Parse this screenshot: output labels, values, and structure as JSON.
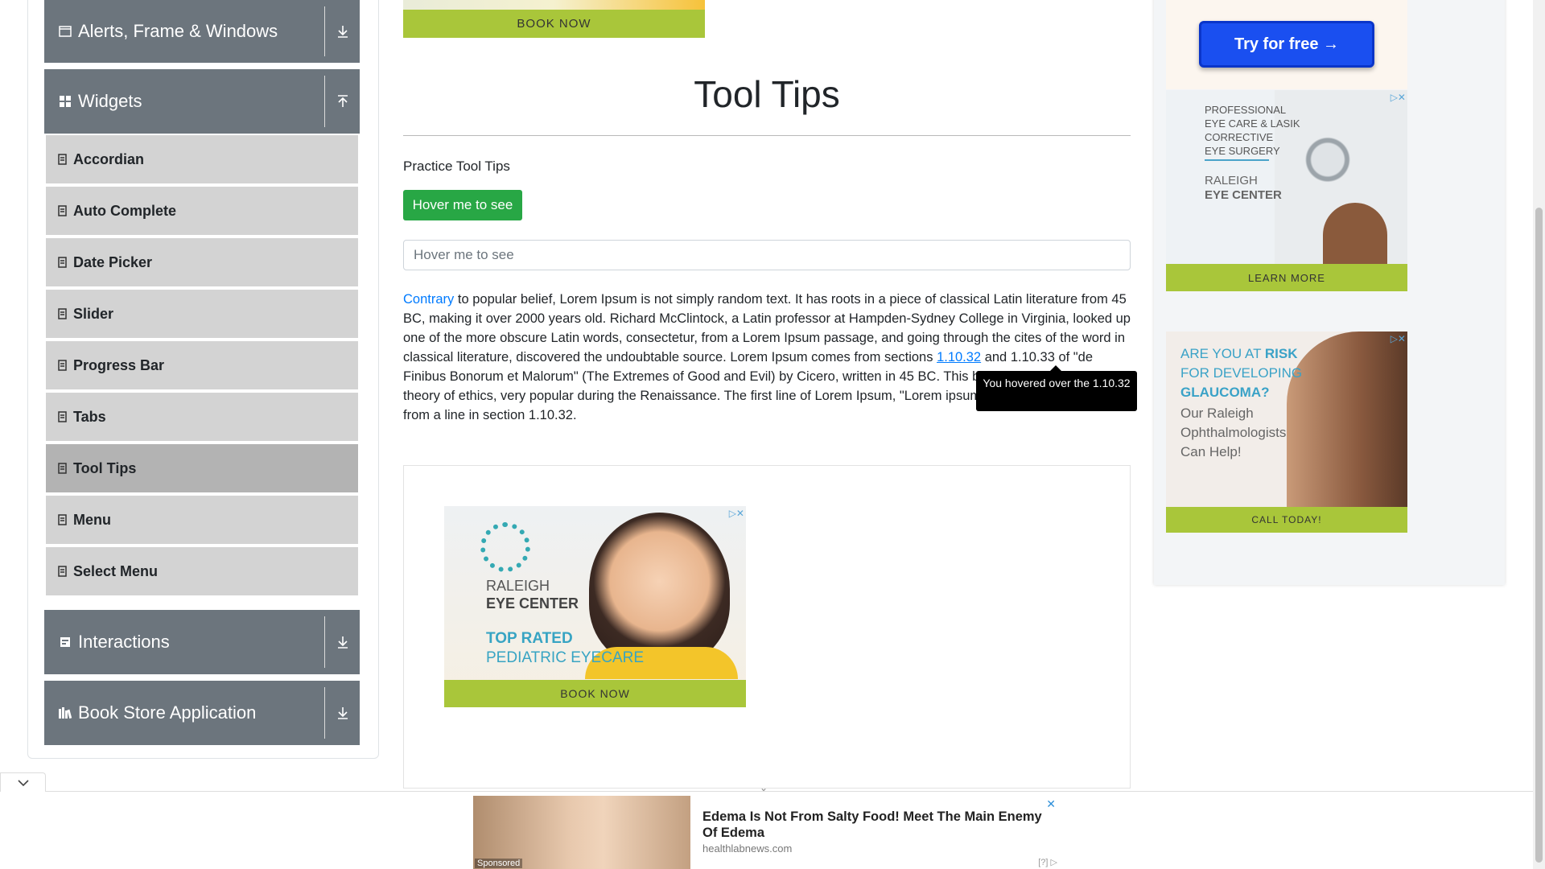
{
  "sidebar": {
    "groups": {
      "alerts": {
        "label": "Alerts, Frame & Windows",
        "icon": "window-icon",
        "arrow": "download-arrow-icon"
      },
      "widgets": {
        "label": "Widgets",
        "icon": "grid-icon",
        "arrow": "upload-arrow-icon"
      },
      "interactions": {
        "label": "Interactions",
        "icon": "interaction-icon",
        "arrow": "download-arrow-icon"
      },
      "bookstore": {
        "label": "Book Store Application",
        "icon": "books-icon",
        "arrow": "download-arrow-icon"
      }
    },
    "items": [
      {
        "label": "Accordian"
      },
      {
        "label": "Auto Complete"
      },
      {
        "label": "Date Picker"
      },
      {
        "label": "Slider"
      },
      {
        "label": "Progress Bar"
      },
      {
        "label": "Tabs"
      },
      {
        "label": "Tool Tips"
      },
      {
        "label": "Menu"
      },
      {
        "label": "Select Menu"
      }
    ],
    "active_item": "Tool Tips"
  },
  "top_banner": {
    "cta": "BOOK NOW"
  },
  "main": {
    "title": "Tool Tips",
    "practice_label": "Practice Tool Tips",
    "hover_button": "Hover me to see",
    "hover_input_placeholder": "Hover me to see",
    "paragraph": {
      "link1": "Contrary",
      "part1": " to popular belief, Lorem Ipsum is not simply random text. It has roots in a piece of classical Latin literature from 45 BC, making it over 2000 years old. Richard McClintock, a Latin professor at Hampden-Sydney College in Virginia, looked up one of the more obscure Latin words, consectetur, from a Lorem Ipsum passage, and going through the cites of the word in classical literature, discovered the undoubtable source. Lorem Ipsum comes from sections ",
      "link2": "1.10.32",
      "part2": " and 1.10.33 of \"de Finibus Bonorum et Malorum\" (The Extremes of Good and Evil) by Cicero, written in 45 BC. This book is a treatise on the theory of ethics, very popular during the Renaissance. The first line of Lorem Ipsum, \"Lorem ipsum dolor sit amet..\", comes from a line in section 1.10.32."
    },
    "tooltip": "You hovered over the 1.10.32"
  },
  "ads": {
    "kid_ad": {
      "brand_line1": "RALEIGH",
      "brand_line2": "EYE CENTER",
      "tagline1": "TOP RATED",
      "tagline2": "PEDIATRIC EYECARE",
      "cta": "BOOK NOW"
    },
    "try_free": "Try for free →",
    "eye_ad": {
      "line1": "PROFESSIONAL",
      "line2": "EYE CARE & LASIK",
      "line3": "CORRECTIVE",
      "line4": "EYE SURGERY",
      "brand1": "RALEIGH",
      "brand2": "EYE CENTER",
      "cta": "LEARN MORE"
    },
    "glaucoma_ad": {
      "h1": "ARE YOU AT ",
      "h1b": "RISK",
      "h2": "FOR DEVELOPING",
      "h3": "GLAUCOMA?",
      "s1": "Our Raleigh",
      "s2": "Ophthalmologists",
      "s3": "Can Help!",
      "cta": "CALL TODAY!"
    },
    "bottom_ad": {
      "sponsored": "Sponsored",
      "headline": "Edema Is Not From Salty Food! Meet The Main Enemy Of Edema",
      "source": "healthlabnews.com",
      "adchoice": "[?]"
    }
  }
}
